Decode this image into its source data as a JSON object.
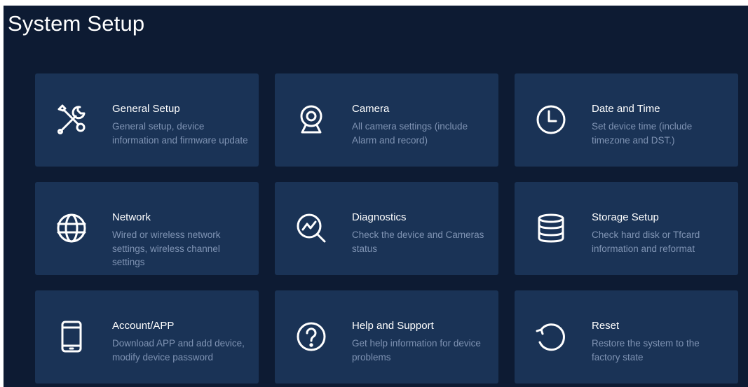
{
  "header": {
    "title": "System Setup"
  },
  "tiles": [
    {
      "title": "General Setup",
      "description": "General setup, device information and firmware update",
      "icon": "tools-icon"
    },
    {
      "title": "Camera",
      "description": "All camera settings (include Alarm and record)",
      "icon": "webcam-icon"
    },
    {
      "title": "Date and Time",
      "description": "Set device time (include timezone and DST.)",
      "icon": "clock-icon"
    },
    {
      "title": "Network",
      "description": "Wired or wireless network settings, wireless channel settings",
      "icon": "globe-icon"
    },
    {
      "title": "Diagnostics",
      "description": "Check the device and Cameras status",
      "icon": "diagnostics-icon"
    },
    {
      "title": "Storage Setup",
      "description": "Check hard disk or Tfcard information and reformat",
      "icon": "database-icon"
    },
    {
      "title": "Account/APP",
      "description": "Download APP and add device, modify device password",
      "icon": "phone-icon"
    },
    {
      "title": "Help and Support",
      "description": "Get help information for device problems",
      "icon": "help-icon"
    },
    {
      "title": "Reset",
      "description": "Restore the system to the factory state",
      "icon": "reset-icon"
    }
  ],
  "colors": {
    "background": "#0d1b33",
    "tile": "#1a3356",
    "title_text": "#ffffff",
    "description_text": "#7f93b3"
  }
}
